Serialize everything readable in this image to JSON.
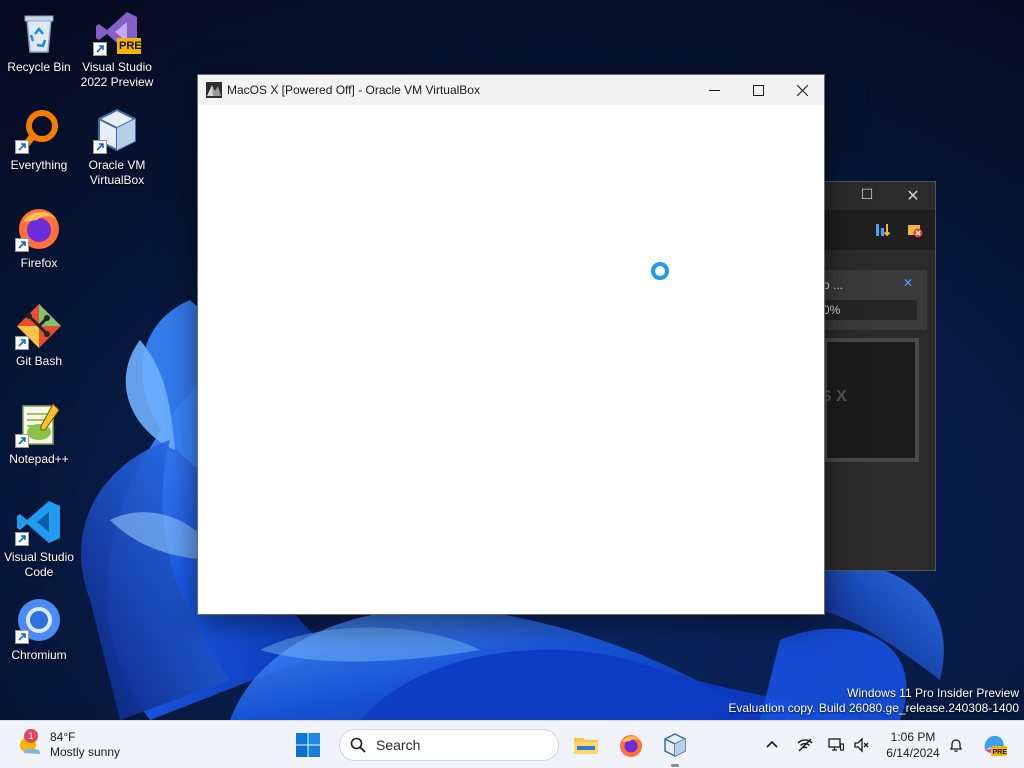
{
  "desktop": {
    "icons": [
      {
        "label": "Recycle Bin",
        "icon": "recycle-bin-icon"
      },
      {
        "label": "Visual Studio 2022 Preview",
        "icon": "visual-studio-preview-icon",
        "badge": "PRE"
      },
      {
        "label": "Everything",
        "icon": "everything-search-icon"
      },
      {
        "label": "Oracle VM VirtualBox",
        "icon": "virtualbox-icon"
      },
      {
        "label": "Firefox",
        "icon": "firefox-icon"
      },
      {
        "label": "Git Bash",
        "icon": "git-bash-icon"
      },
      {
        "label": "Notepad++",
        "icon": "notepad-plus-plus-icon"
      },
      {
        "label": "Visual Studio Code",
        "icon": "vscode-icon"
      },
      {
        "label": "Chromium",
        "icon": "chromium-icon"
      }
    ]
  },
  "vbox_window": {
    "title": "MacOS X [Powered Off] - Oracle VM VirtualBox"
  },
  "bg_window": {
    "panel_text": "o ...",
    "progress_text": "0%",
    "preview_text": "S X"
  },
  "watermark": {
    "line1": "Windows 11 Pro Insider Preview",
    "line2": "Evaluation copy. Build 26080.ge_release.240308-1400"
  },
  "taskbar": {
    "weather_temp": "84°F",
    "weather_desc": "Mostly sunny",
    "weather_badge": "1",
    "search_label": "Search",
    "time": "1:06 PM",
    "date": "6/14/2024"
  },
  "colors": {
    "accent": "#0078d4",
    "taskbar_bg": "#f0f3f9",
    "spinner": "#1e9bf0"
  }
}
